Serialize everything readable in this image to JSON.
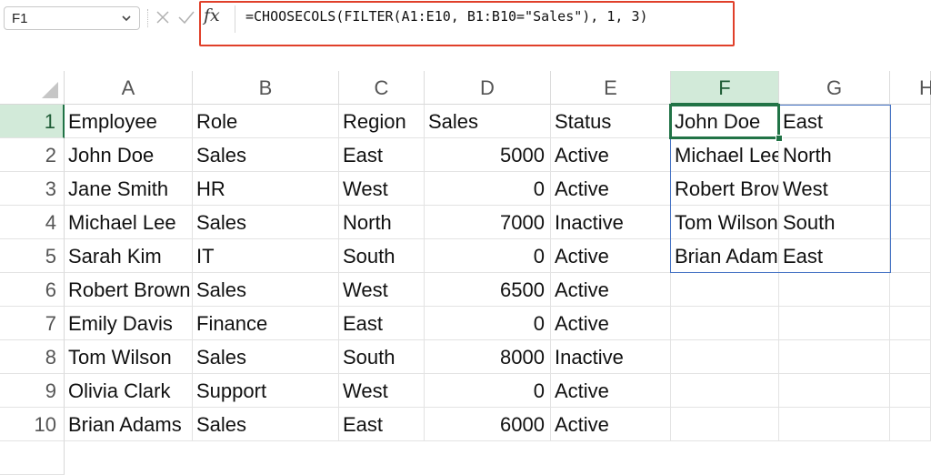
{
  "name_box": {
    "value": "F1"
  },
  "formula_bar": {
    "fx_label": "fx",
    "formula": "=CHOOSECOLS(FILTER(A1:E10, B1:B10=\"Sales\"), 1, 3)"
  },
  "columns": [
    "A",
    "B",
    "C",
    "D",
    "E",
    "F",
    "G",
    "H"
  ],
  "rows": [
    "1",
    "2",
    "3",
    "4",
    "5",
    "6",
    "7",
    "8",
    "9",
    "10"
  ],
  "cells": [
    [
      "Employee",
      "Role",
      "Region",
      "Sales",
      "Status",
      "John Doe",
      "East"
    ],
    [
      "John Doe",
      "Sales",
      "East",
      "5000",
      "Active",
      "Michael Lee",
      "North"
    ],
    [
      "Jane Smith",
      "HR",
      "West",
      "0",
      "Active",
      "Robert Brown",
      "West"
    ],
    [
      "Michael Lee",
      "Sales",
      "North",
      "7000",
      "Inactive",
      "Tom Wilson",
      "South"
    ],
    [
      "Sarah Kim",
      "IT",
      "South",
      "0",
      "Active",
      "Brian Adams",
      "East"
    ],
    [
      "Robert Brown",
      "Sales",
      "West",
      "6500",
      "Active",
      "",
      ""
    ],
    [
      "Emily Davis",
      "Finance",
      "East",
      "0",
      "Active",
      "",
      ""
    ],
    [
      "Tom Wilson",
      "Sales",
      "South",
      "8000",
      "Inactive",
      "",
      ""
    ],
    [
      "Olivia Clark",
      "Support",
      "West",
      "0",
      "Active",
      "",
      ""
    ],
    [
      "Brian Adams",
      "Sales",
      "East",
      "6000",
      "Active",
      "",
      ""
    ]
  ],
  "selection": {
    "cell": "F1",
    "column": "F",
    "row": "1"
  },
  "colors": {
    "accent": "#217346",
    "spill": "#4472c4",
    "highlight": "#e0402a",
    "header_selected_bg": "#d2ead9"
  }
}
